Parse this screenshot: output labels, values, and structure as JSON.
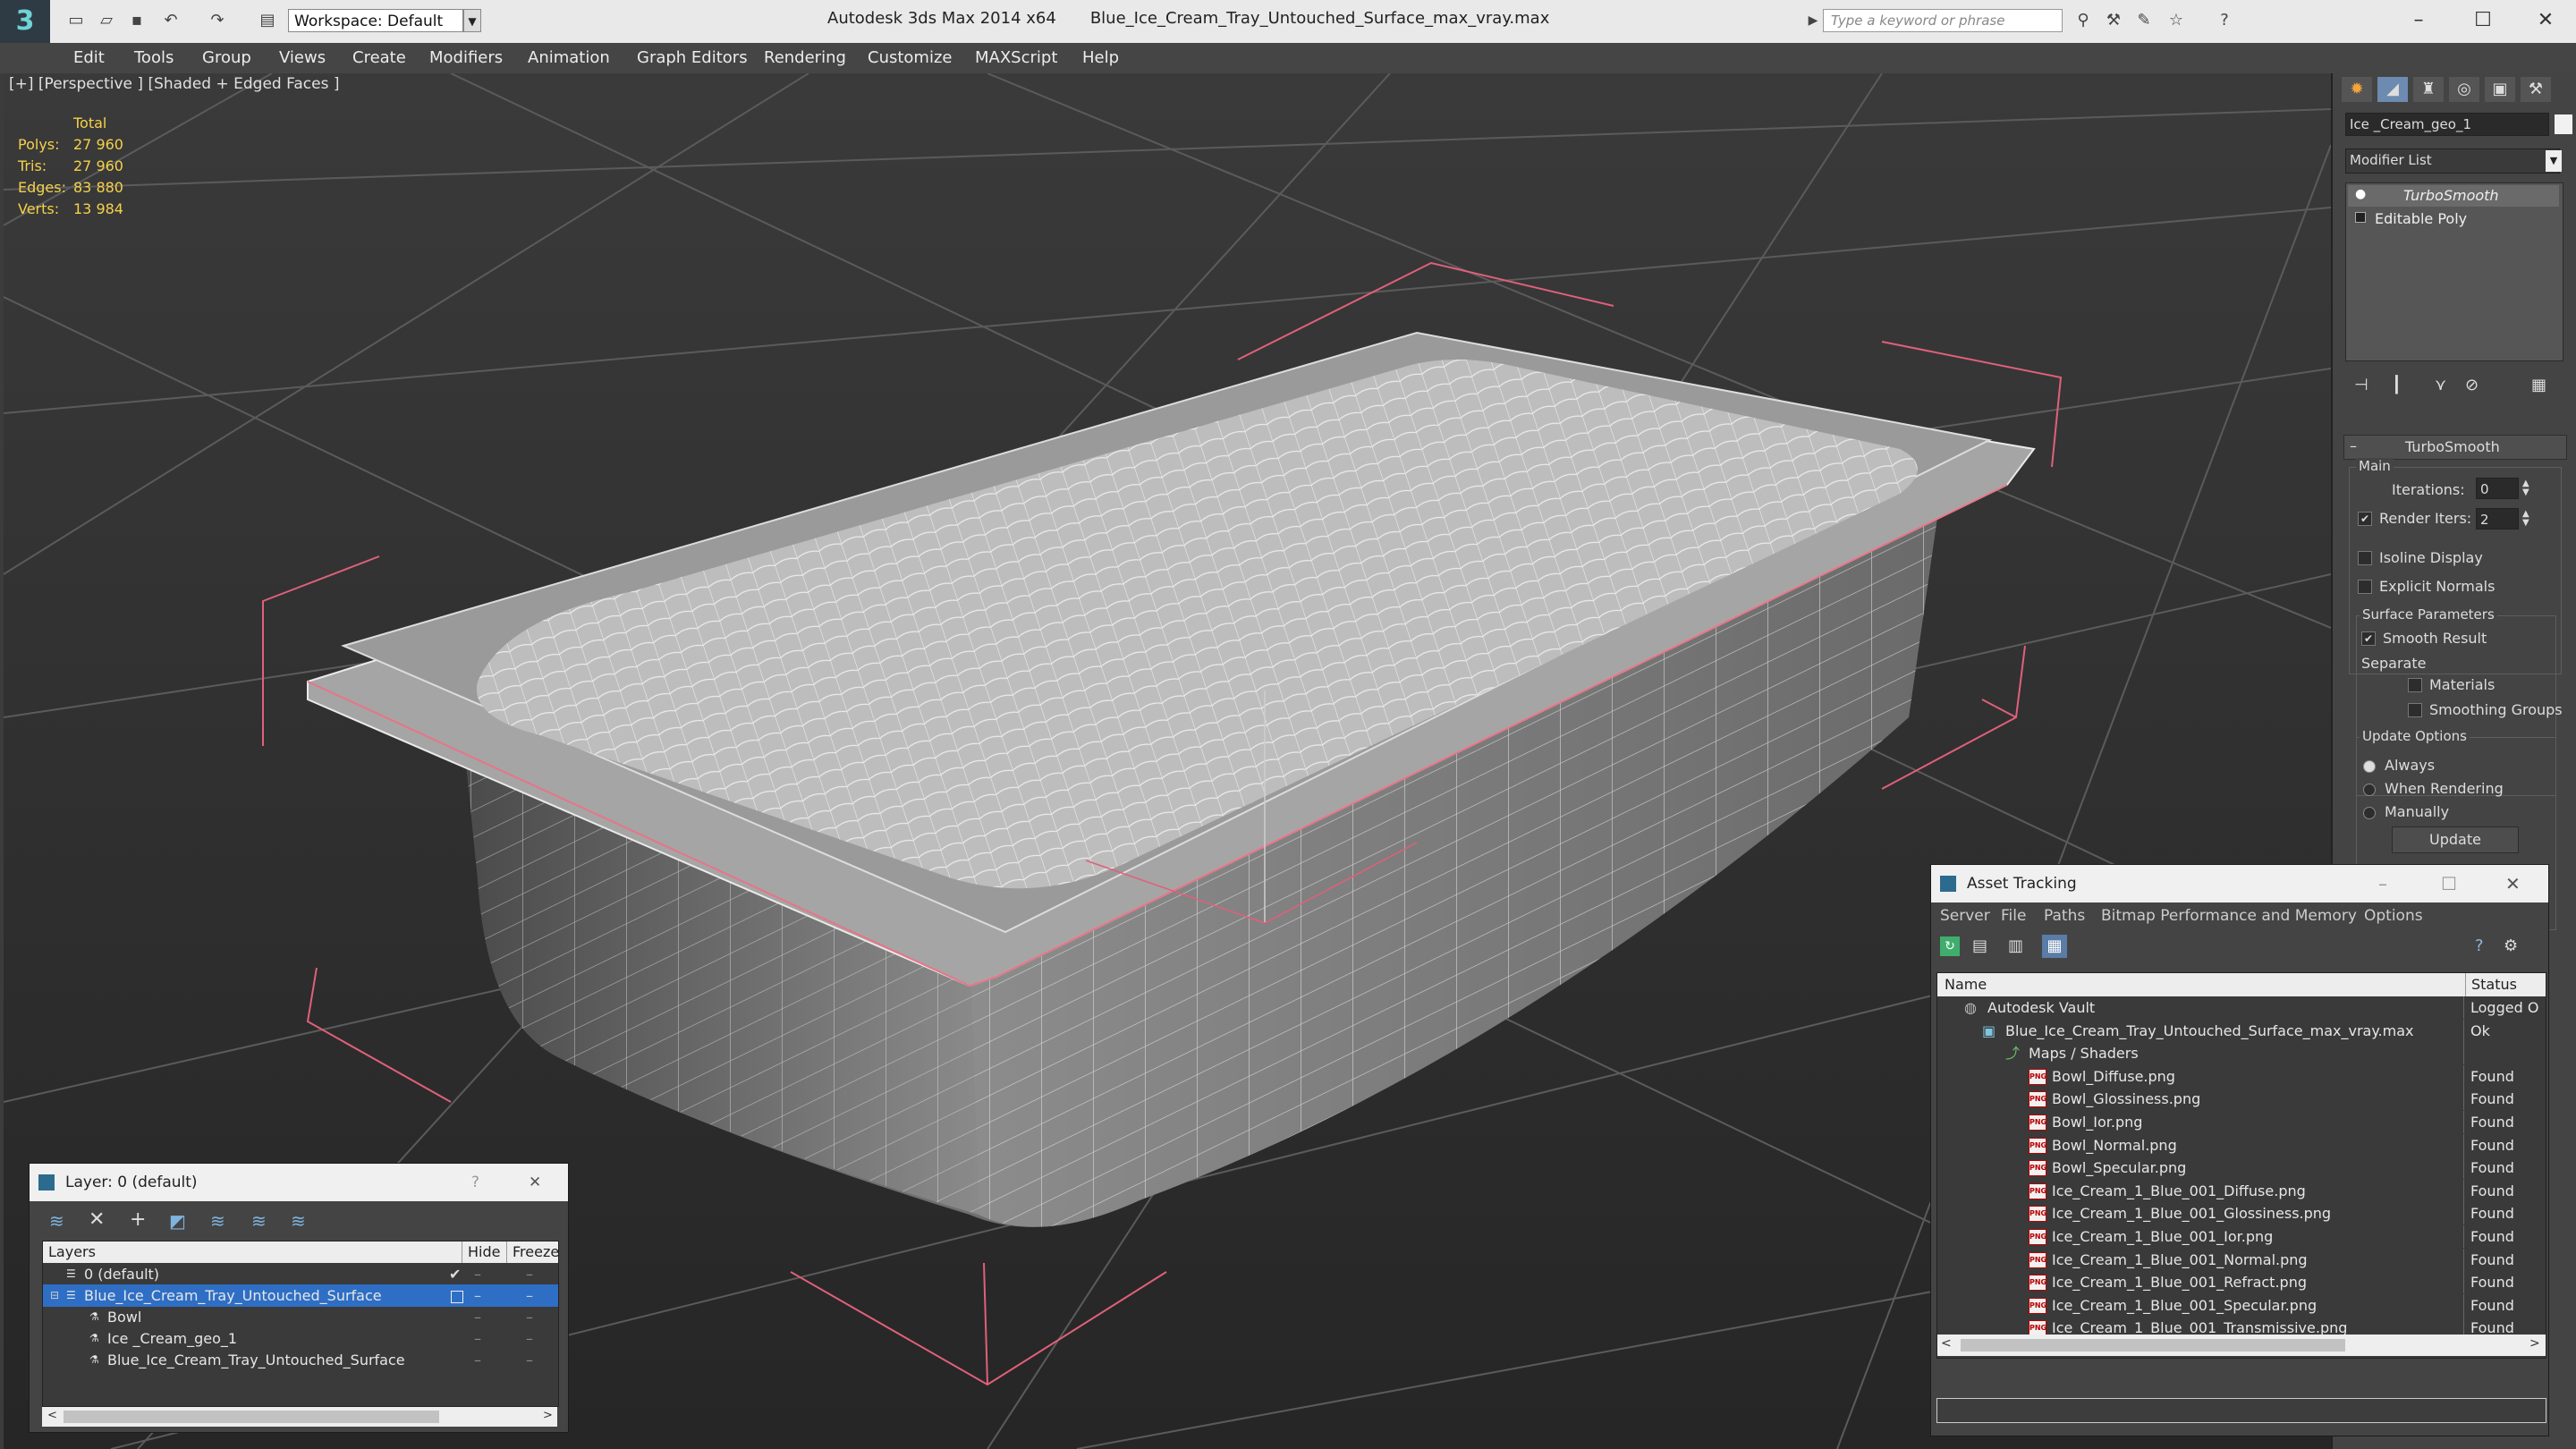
{
  "titlebar": {
    "app_title": "Autodesk 3ds Max  2014 x64",
    "file_name": "Blue_Ice_Cream_Tray_Untouched_Surface_max_vray.max",
    "workspace": "Workspace: Default",
    "search_placeholder": "Type a keyword or phrase"
  },
  "menu": {
    "items": [
      "Edit",
      "Tools",
      "Group",
      "Views",
      "Create",
      "Modifiers",
      "Animation",
      "Graph Editors",
      "Rendering",
      "Customize",
      "MAXScript",
      "Help"
    ]
  },
  "viewport": {
    "label": "[+] [Perspective ] [Shaded + Edged Faces ]",
    "stats": {
      "header": "Total",
      "polys_label": "Polys:",
      "polys": "27 960",
      "tris_label": "Tris:",
      "tris": "27 960",
      "edges_label": "Edges:",
      "edges": "83 880",
      "verts_label": "Verts:",
      "verts": "13 984"
    }
  },
  "command_panel": {
    "object_name": "Ice _Cream_geo_1",
    "modifier_list": "Modifier List",
    "stack": [
      "TurboSmooth",
      "Editable Poly"
    ],
    "rollout_title": "TurboSmooth",
    "main_label": "Main",
    "iterations_label": "Iterations:",
    "iterations": "0",
    "render_iters_label": "Render Iters:",
    "render_iters": "2",
    "isoline": "Isoline Display",
    "explicit_normals": "Explicit Normals",
    "surface_params": "Surface Parameters",
    "smooth_result": "Smooth Result",
    "separate": "Separate",
    "materials": "Materials",
    "smoothing_groups": "Smoothing Groups",
    "update_options": "Update Options",
    "always": "Always",
    "when_rendering": "When Rendering",
    "manually": "Manually",
    "update_button": "Update"
  },
  "layer_panel": {
    "title": "Layer: 0 (default)",
    "help": "?",
    "close": "✕",
    "columns": [
      "Layers",
      "Hide",
      "Freeze"
    ],
    "rows": [
      {
        "name": "0 (default)"
      },
      {
        "name": "Blue_Ice_Cream_Tray_Untouched_Surface"
      },
      {
        "name": "Bowl"
      },
      {
        "name": "Ice _Cream_geo_1"
      },
      {
        "name": "Blue_Ice_Cream_Tray_Untouched_Surface"
      }
    ]
  },
  "asset_panel": {
    "title": "Asset Tracking",
    "menu": [
      "Server",
      "File",
      "Paths",
      "Bitmap Performance and Memory",
      "Options"
    ],
    "columns": [
      "Name",
      "Status"
    ],
    "rows": [
      {
        "name": "Autodesk Vault",
        "status": "Logged O"
      },
      {
        "name": "Blue_Ice_Cream_Tray_Untouched_Surface_max_vray.max",
        "status": "Ok"
      },
      {
        "name": "Maps / Shaders",
        "status": ""
      },
      {
        "name": "Bowl_Diffuse.png",
        "status": "Found"
      },
      {
        "name": "Bowl_Glossiness.png",
        "status": "Found"
      },
      {
        "name": "Bowl_Ior.png",
        "status": "Found"
      },
      {
        "name": "Bowl_Normal.png",
        "status": "Found"
      },
      {
        "name": "Bowl_Specular.png",
        "status": "Found"
      },
      {
        "name": "Ice_Cream_1_Blue_001_Diffuse.png",
        "status": "Found"
      },
      {
        "name": "Ice_Cream_1_Blue_001_Glossiness.png",
        "status": "Found"
      },
      {
        "name": "Ice_Cream_1_Blue_001_Ior.png",
        "status": "Found"
      },
      {
        "name": "Ice_Cream_1_Blue_001_Normal.png",
        "status": "Found"
      },
      {
        "name": "Ice_Cream_1_Blue_001_Refract.png",
        "status": "Found"
      },
      {
        "name": "Ice_Cream_1_Blue_001_Specular.png",
        "status": "Found"
      },
      {
        "name": "Ice_Cream_1_Blue_001_Transmissive.png",
        "status": "Found"
      }
    ]
  }
}
